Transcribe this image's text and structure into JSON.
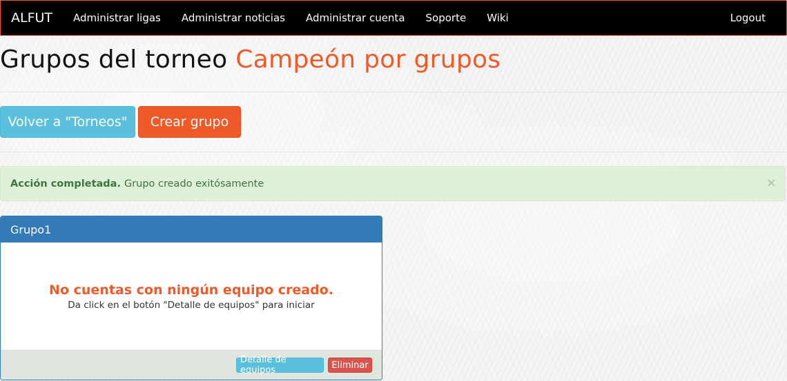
{
  "navbar": {
    "brand": "ALFUT",
    "items": [
      {
        "label": "Administrar ligas"
      },
      {
        "label": "Administrar noticias"
      },
      {
        "label": "Administrar cuenta"
      },
      {
        "label": "Soporte"
      },
      {
        "label": "Wiki"
      }
    ],
    "logout": "Logout"
  },
  "page": {
    "title_prefix": "Grupos del torneo",
    "title_accent": "Campeón por grupos"
  },
  "actions": {
    "back_label": "Volver a \"Torneos\"",
    "create_label": "Crear grupo"
  },
  "alert": {
    "strong": "Acción completada.",
    "message": "Grupo creado exitósamente",
    "close_symbol": "×"
  },
  "group_panel": {
    "title": "Grupo1",
    "empty_title": "No cuentas con ningún equipo creado.",
    "empty_subtitle": "Da click en el botón \"Detalle de equipos\" para iniciar",
    "details_label": "Detalle de equipos",
    "delete_label": "Eliminar"
  },
  "colors": {
    "accent": "#f05a28",
    "info": "#5bc0de",
    "primary": "#337ab7",
    "danger": "#d9534f",
    "success_bg": "#dff0d8"
  }
}
